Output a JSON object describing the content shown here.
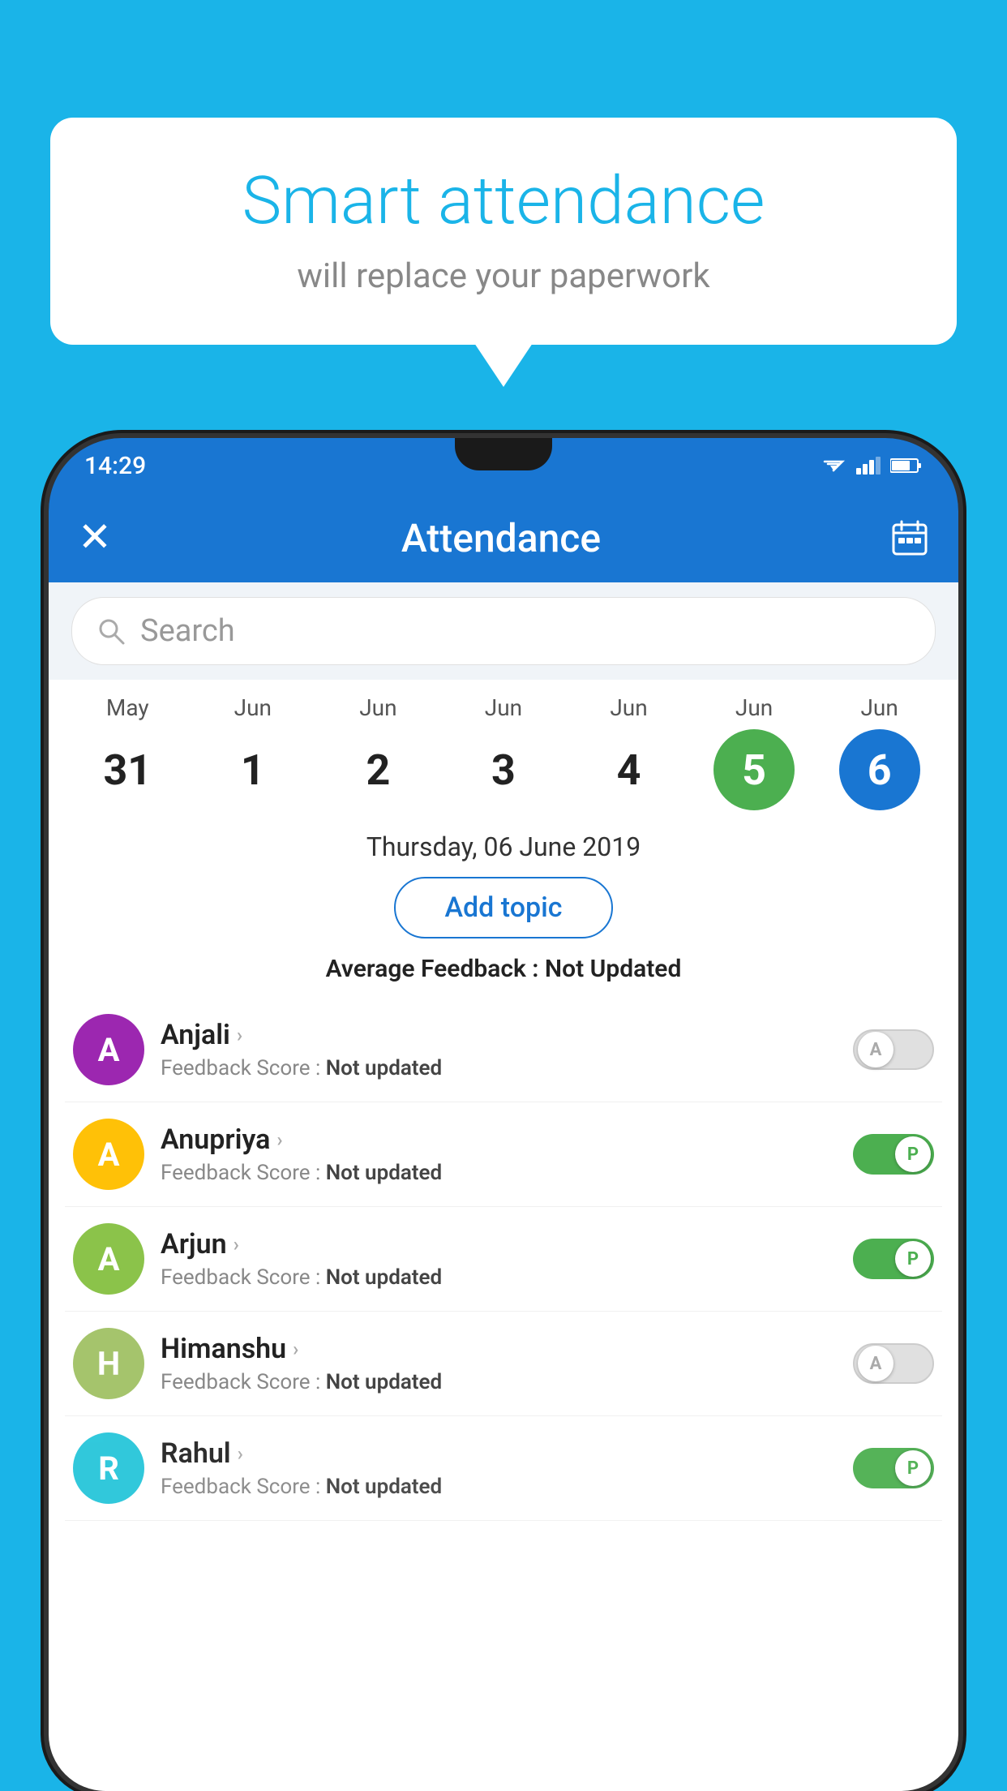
{
  "background_color": "#1ab4e8",
  "bubble": {
    "title": "Smart attendance",
    "subtitle": "will replace your paperwork"
  },
  "status_bar": {
    "time": "14:29",
    "wifi": "▲",
    "signal": "▲",
    "battery": "▮"
  },
  "app_bar": {
    "title": "Attendance",
    "close_icon": "✕",
    "calendar_icon": "📅"
  },
  "search": {
    "placeholder": "Search"
  },
  "calendar": {
    "days": [
      {
        "month": "May",
        "date": "31",
        "state": "normal"
      },
      {
        "month": "Jun",
        "date": "1",
        "state": "normal"
      },
      {
        "month": "Jun",
        "date": "2",
        "state": "normal"
      },
      {
        "month": "Jun",
        "date": "3",
        "state": "normal"
      },
      {
        "month": "Jun",
        "date": "4",
        "state": "normal"
      },
      {
        "month": "Jun",
        "date": "5",
        "state": "today"
      },
      {
        "month": "Jun",
        "date": "6",
        "state": "selected"
      }
    ]
  },
  "selected_date_label": "Thursday, 06 June 2019",
  "add_topic_label": "Add topic",
  "avg_feedback": {
    "label": "Average Feedback : ",
    "value": "Not Updated"
  },
  "students": [
    {
      "name": "Anjali",
      "initial": "A",
      "avatar_color": "#9c27b0",
      "feedback_label": "Feedback Score : ",
      "feedback_value": "Not updated",
      "toggle_state": "off",
      "toggle_label": "A"
    },
    {
      "name": "Anupriya",
      "initial": "A",
      "avatar_color": "#ffc107",
      "feedback_label": "Feedback Score : ",
      "feedback_value": "Not updated",
      "toggle_state": "on",
      "toggle_label": "P"
    },
    {
      "name": "Arjun",
      "initial": "A",
      "avatar_color": "#8bc34a",
      "feedback_label": "Feedback Score : ",
      "feedback_value": "Not updated",
      "toggle_state": "on",
      "toggle_label": "P"
    },
    {
      "name": "Himanshu",
      "initial": "H",
      "avatar_color": "#a5c46c",
      "feedback_label": "Feedback Score : ",
      "feedback_value": "Not updated",
      "toggle_state": "off",
      "toggle_label": "A"
    },
    {
      "name": "Rahul",
      "initial": "R",
      "avatar_color": "#26c6da",
      "feedback_label": "Feedback Score : ",
      "feedback_value": "Not updated",
      "toggle_state": "on",
      "toggle_label": "P"
    }
  ]
}
